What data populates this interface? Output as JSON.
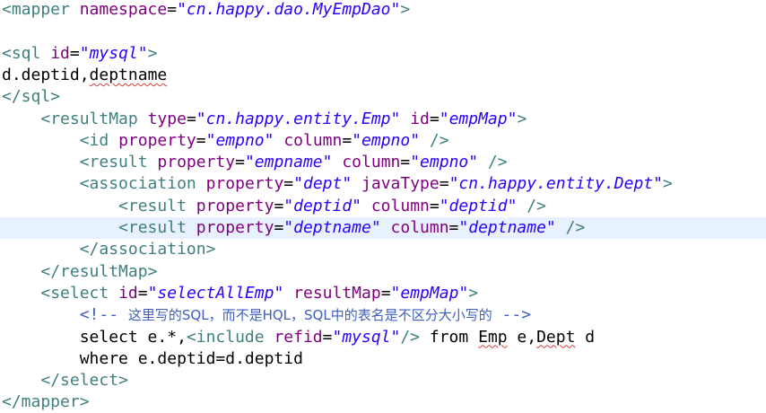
{
  "lines": [
    {
      "tokens": [
        {
          "k": "tag",
          "t": "<mapper"
        },
        {
          "k": "txt",
          "t": " "
        },
        {
          "k": "attr",
          "t": "namespace"
        },
        {
          "k": "txt",
          "t": "="
        },
        {
          "k": "val",
          "t": "\"cn.happy.dao.MyEmpDao\""
        },
        {
          "k": "tag",
          "t": ">"
        }
      ]
    },
    {
      "tokens": []
    },
    {
      "tokens": [
        {
          "k": "tag",
          "t": "<sql"
        },
        {
          "k": "txt",
          "t": " "
        },
        {
          "k": "attr",
          "t": "id"
        },
        {
          "k": "txt",
          "t": "="
        },
        {
          "k": "val",
          "t": "\"mysql\""
        },
        {
          "k": "tag",
          "t": ">"
        }
      ]
    },
    {
      "tokens": [
        {
          "k": "txt",
          "t": "d.deptid,"
        },
        {
          "k": "txt",
          "t": "deptname",
          "sq": true
        }
      ]
    },
    {
      "tokens": [
        {
          "k": "tag",
          "t": "</sql>"
        }
      ]
    },
    {
      "tokens": [
        {
          "k": "txt",
          "t": "    "
        },
        {
          "k": "tag",
          "t": "<resultMap"
        },
        {
          "k": "txt",
          "t": " "
        },
        {
          "k": "attr",
          "t": "type"
        },
        {
          "k": "txt",
          "t": "="
        },
        {
          "k": "val",
          "t": "\"cn.happy.entity.Emp\""
        },
        {
          "k": "txt",
          "t": " "
        },
        {
          "k": "attr",
          "t": "id"
        },
        {
          "k": "txt",
          "t": "="
        },
        {
          "k": "val",
          "t": "\"empMap\""
        },
        {
          "k": "tag",
          "t": ">"
        }
      ]
    },
    {
      "tokens": [
        {
          "k": "txt",
          "t": "        "
        },
        {
          "k": "tag",
          "t": "<id"
        },
        {
          "k": "txt",
          "t": " "
        },
        {
          "k": "attr",
          "t": "property"
        },
        {
          "k": "txt",
          "t": "="
        },
        {
          "k": "val",
          "t": "\"empno\""
        },
        {
          "k": "txt",
          "t": " "
        },
        {
          "k": "attr",
          "t": "column"
        },
        {
          "k": "txt",
          "t": "="
        },
        {
          "k": "val",
          "t": "\"empno\""
        },
        {
          "k": "txt",
          "t": " "
        },
        {
          "k": "tag",
          "t": "/>"
        }
      ]
    },
    {
      "tokens": [
        {
          "k": "txt",
          "t": "        "
        },
        {
          "k": "tag",
          "t": "<result"
        },
        {
          "k": "txt",
          "t": " "
        },
        {
          "k": "attr",
          "t": "property"
        },
        {
          "k": "txt",
          "t": "="
        },
        {
          "k": "val",
          "t": "\"empname\""
        },
        {
          "k": "txt",
          "t": " "
        },
        {
          "k": "attr",
          "t": "column"
        },
        {
          "k": "txt",
          "t": "="
        },
        {
          "k": "val",
          "t": "\"empno\""
        },
        {
          "k": "txt",
          "t": " "
        },
        {
          "k": "tag",
          "t": "/>"
        }
      ]
    },
    {
      "tokens": [
        {
          "k": "txt",
          "t": "        "
        },
        {
          "k": "tag",
          "t": "<association"
        },
        {
          "k": "txt",
          "t": " "
        },
        {
          "k": "attr",
          "t": "property"
        },
        {
          "k": "txt",
          "t": "="
        },
        {
          "k": "val",
          "t": "\"dept\""
        },
        {
          "k": "txt",
          "t": " "
        },
        {
          "k": "attr",
          "t": "javaType"
        },
        {
          "k": "txt",
          "t": "="
        },
        {
          "k": "val",
          "t": "\"cn.happy.entity.Dept\""
        },
        {
          "k": "tag",
          "t": ">"
        }
      ]
    },
    {
      "tokens": [
        {
          "k": "txt",
          "t": "            "
        },
        {
          "k": "tag",
          "t": "<result"
        },
        {
          "k": "txt",
          "t": " "
        },
        {
          "k": "attr",
          "t": "property"
        },
        {
          "k": "txt",
          "t": "="
        },
        {
          "k": "val",
          "t": "\"deptid\""
        },
        {
          "k": "txt",
          "t": " "
        },
        {
          "k": "attr",
          "t": "column"
        },
        {
          "k": "txt",
          "t": "="
        },
        {
          "k": "val",
          "t": "\"deptid\""
        },
        {
          "k": "txt",
          "t": " "
        },
        {
          "k": "tag",
          "t": "/>"
        }
      ]
    },
    {
      "highlight": true,
      "tokens": [
        {
          "k": "txt",
          "t": "            "
        },
        {
          "k": "tag",
          "t": "<result"
        },
        {
          "k": "txt",
          "t": " "
        },
        {
          "k": "attr",
          "t": "property"
        },
        {
          "k": "txt",
          "t": "="
        },
        {
          "k": "val",
          "t": "\"deptname\""
        },
        {
          "k": "txt",
          "t": " "
        },
        {
          "k": "attr",
          "t": "column"
        },
        {
          "k": "txt",
          "t": "="
        },
        {
          "k": "val",
          "t": "\"deptname\""
        },
        {
          "k": "txt",
          "t": " "
        },
        {
          "k": "tag",
          "t": "/>"
        }
      ]
    },
    {
      "tokens": [
        {
          "k": "txt",
          "t": "        "
        },
        {
          "k": "tag",
          "t": "</association>"
        }
      ]
    },
    {
      "tokens": [
        {
          "k": "txt",
          "t": "    "
        },
        {
          "k": "tag",
          "t": "</resultMap>"
        }
      ]
    },
    {
      "tokens": [
        {
          "k": "txt",
          "t": "    "
        },
        {
          "k": "tag",
          "t": "<select"
        },
        {
          "k": "txt",
          "t": " "
        },
        {
          "k": "attr",
          "t": "id"
        },
        {
          "k": "txt",
          "t": "="
        },
        {
          "k": "val",
          "t": "\"selectAllEmp\""
        },
        {
          "k": "txt",
          "t": " "
        },
        {
          "k": "attr",
          "t": "resultMap"
        },
        {
          "k": "txt",
          "t": "="
        },
        {
          "k": "val",
          "t": "\"empMap\""
        },
        {
          "k": "tag",
          "t": ">"
        }
      ]
    },
    {
      "tokens": [
        {
          "k": "txt",
          "t": "        "
        },
        {
          "k": "cmt",
          "t": "<!-- "
        },
        {
          "k": "cmt-cjk",
          "t": "这里写的SQL，而不是HQL，SQL中的表名是不区分大小写的"
        },
        {
          "k": "cmt",
          "t": " -->"
        }
      ]
    },
    {
      "tokens": [
        {
          "k": "txt",
          "t": "        select e.*,"
        },
        {
          "k": "tag",
          "t": "<include"
        },
        {
          "k": "txt",
          "t": " "
        },
        {
          "k": "attr",
          "t": "refid"
        },
        {
          "k": "txt",
          "t": "="
        },
        {
          "k": "val",
          "t": "\"mysql\""
        },
        {
          "k": "tag",
          "t": "/>"
        },
        {
          "k": "txt",
          "t": " from "
        },
        {
          "k": "txt",
          "t": "Emp",
          "sq": true
        },
        {
          "k": "txt",
          "t": " e,"
        },
        {
          "k": "txt",
          "t": "Dept",
          "sq": true
        },
        {
          "k": "txt",
          "t": " d"
        }
      ]
    },
    {
      "tokens": [
        {
          "k": "txt",
          "t": "        where e.deptid=d.deptid"
        }
      ]
    },
    {
      "tokens": [
        {
          "k": "txt",
          "t": "    "
        },
        {
          "k": "tag",
          "t": "</select>"
        }
      ]
    },
    {
      "tokens": [
        {
          "k": "tag",
          "t": "</mapper>"
        }
      ]
    }
  ]
}
